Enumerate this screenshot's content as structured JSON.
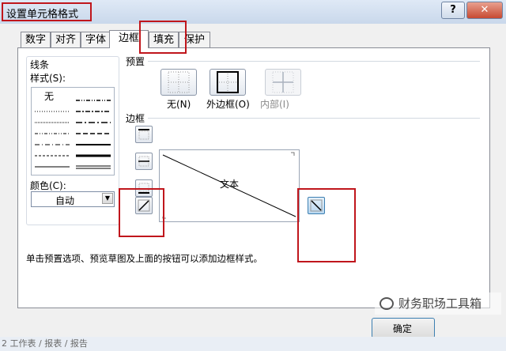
{
  "window": {
    "title": "设置单元格格式",
    "help_label": "?",
    "close_label": "✕"
  },
  "tabs": [
    "数字",
    "对齐",
    "字体",
    "边框",
    "填充",
    "保护"
  ],
  "active_tab": "边框",
  "line_group": {
    "title": "线条",
    "style_label": "样式(S):",
    "none_label": "无",
    "color_label": "颜色(C):",
    "color_value": "自动"
  },
  "presets": {
    "title": "预置",
    "none": "无(N)",
    "outline": "外边框(O)",
    "inside": "内部(I)"
  },
  "border": {
    "title": "边框",
    "preview_text": "文本"
  },
  "hint_text": "单击预置选项、预览草图及上面的按钮可以添加边框样式。",
  "buttons": {
    "ok": "确定"
  },
  "watermark": "财务职场工具箱",
  "status_bar": "2 工作表 / 报表 / 报告",
  "colors": {
    "highlight": "#c0161c",
    "accent": "#3c7fb1"
  }
}
